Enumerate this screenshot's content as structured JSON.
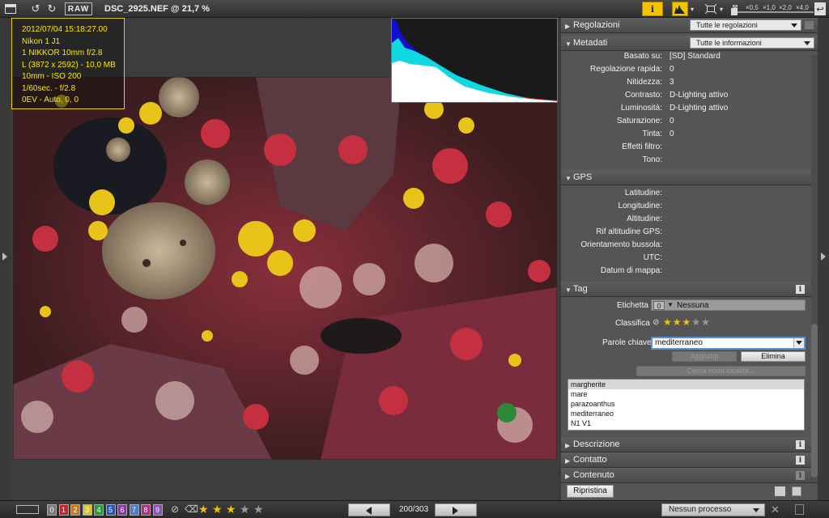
{
  "toolbar": {
    "raw_label": "RAW",
    "filename": "DSC_2925.NEF @ 21,7 %",
    "info_label": "i",
    "zoom_levels": [
      "×0,5",
      "×1,0",
      "×2,0",
      "×4,0"
    ],
    "icons": [
      "panel-icon",
      "rotate-left-icon",
      "rotate-right-icon",
      "info-icon",
      "histogram-icon",
      "fit-icon",
      "undo-icon"
    ]
  },
  "overlay": {
    "lines": [
      "2012/07/04 15:18:27.00",
      "Nikon 1 J1",
      "1 NIKKOR 10mm f/2.8",
      "L (3872 x 2592) - 10,0 MB",
      "10mm - ISO 200",
      "1/60sec. - f/2.8",
      "0EV - Auto, 0, 0"
    ]
  },
  "panel": {
    "regolazioni": {
      "title": "Regolazioni",
      "dropdown": "Tutte le regolazioni"
    },
    "metadati": {
      "title": "Metadati",
      "dropdown": "Tutte le informazioni"
    },
    "meta_rows": [
      {
        "label": "Basato su:",
        "value": "[SD] Standard"
      },
      {
        "label": "Regolazione rapida:",
        "value": "0"
      },
      {
        "label": "Nitidezza:",
        "value": "3"
      },
      {
        "label": "Contrasto:",
        "value": "D-Lighting attivo"
      },
      {
        "label": "Luminosità:",
        "value": "D-Lighting attivo"
      },
      {
        "label": "Saturazione:",
        "value": "0"
      },
      {
        "label": "Tinta:",
        "value": "0"
      },
      {
        "label": "Effetti filtro:",
        "value": ""
      },
      {
        "label": "Tono:",
        "value": ""
      }
    ],
    "gps": {
      "title": "GPS",
      "rows": [
        {
          "label": "Latitudine:",
          "value": ""
        },
        {
          "label": "Longitudine:",
          "value": ""
        },
        {
          "label": "Altitudine:",
          "value": ""
        },
        {
          "label": "Rif altitudine GPS:",
          "value": ""
        },
        {
          "label": "Orientamento bussola:",
          "value": ""
        },
        {
          "label": "UTC:",
          "value": ""
        },
        {
          "label": "Datum di mappa:",
          "value": ""
        }
      ]
    },
    "tag": {
      "title": "Tag",
      "etichetta_label": "Etichetta",
      "etichetta_num": "0",
      "etichetta_value": "Nessuna",
      "classifica_label": "Classifica",
      "rating": 3,
      "rating_max": 5,
      "parole_label": "Parole chiave",
      "keyword_value": "mediterraneo",
      "aggiungi_label": "Aggiungi",
      "elimina_label": "Elimina",
      "cerca_label": "Cerca nomi località...",
      "keywords": [
        "margherite",
        "mare",
        "parazoanthus",
        "mediterraneo",
        "N1 V1"
      ]
    },
    "descrizione": "Descrizione",
    "contatto": "Contatto",
    "contenuto": "Contenuto",
    "ripristina_label": "Ripristina"
  },
  "bottom": {
    "labels": [
      "0",
      "1",
      "2",
      "3",
      "4",
      "5",
      "6",
      "7",
      "8",
      "9"
    ],
    "label_colors": [
      "#7a7a7a",
      "#c0282a",
      "#c87a1c",
      "#d4c82a",
      "#2f9a3a",
      "#2a55b4",
      "#8a3aa8",
      "#4c7cc8",
      "#b0307a",
      "#8a4fb8"
    ],
    "rating": 3,
    "rating_max": 5,
    "counter": "200/303",
    "process": "Nessun processo"
  },
  "colors": {
    "accent": "#f2c400",
    "overlay_text": "#ffe800",
    "focus": "#5b8fd6"
  }
}
